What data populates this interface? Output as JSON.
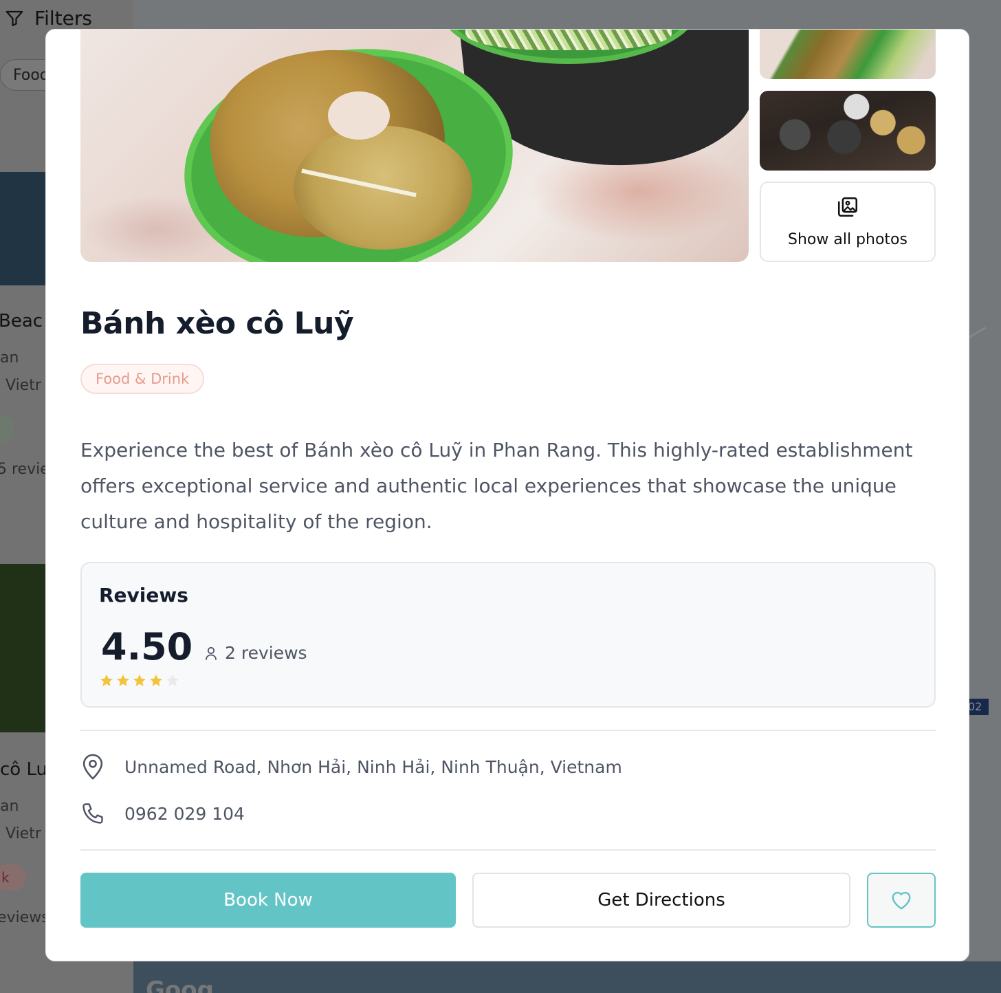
{
  "background": {
    "filters_label": "Filters",
    "chip_label": "Food",
    "card1_title": "Beac",
    "card1_line1": "an",
    "card1_line2": "Vietr",
    "card1_reviews": "5 review",
    "card2_title": "cô Lu",
    "card2_line1": "an",
    "card2_line2": "Vietr",
    "card2_badge": "k",
    "card2_reviews": "eviews",
    "map_marker": "02",
    "map_logo": "Goog"
  },
  "modal": {
    "show_all_photos": "Show all photos",
    "title": "Bánh xèo cô Luỹ",
    "category": "Food & Drink",
    "description": "Experience the best of Bánh xèo cô Luỹ in Phan Rang. This highly-rated establishment offers exceptional service and authentic local experiences that showcase the unique culture and hospitality of the region.",
    "reviews": {
      "heading": "Reviews",
      "rating": "4.50",
      "rating_value": 4.5,
      "rating_max": 5,
      "count": "2 reviews"
    },
    "address": "Unnamed Road, Nhơn Hải, Ninh Hải, Ninh Thuận, Vietnam",
    "phone": "0962 029 104",
    "actions": {
      "book": "Book Now",
      "directions": "Get Directions"
    },
    "colors": {
      "accent": "#63c4c6",
      "star_filled": "#f5c33b",
      "star_empty": "#e9e9e9",
      "badge_text": "#e89a8e"
    },
    "icons": {
      "gallery": "images-icon",
      "user": "user-icon",
      "location": "map-pin-icon",
      "phone": "phone-icon",
      "favorite": "heart-icon"
    }
  }
}
